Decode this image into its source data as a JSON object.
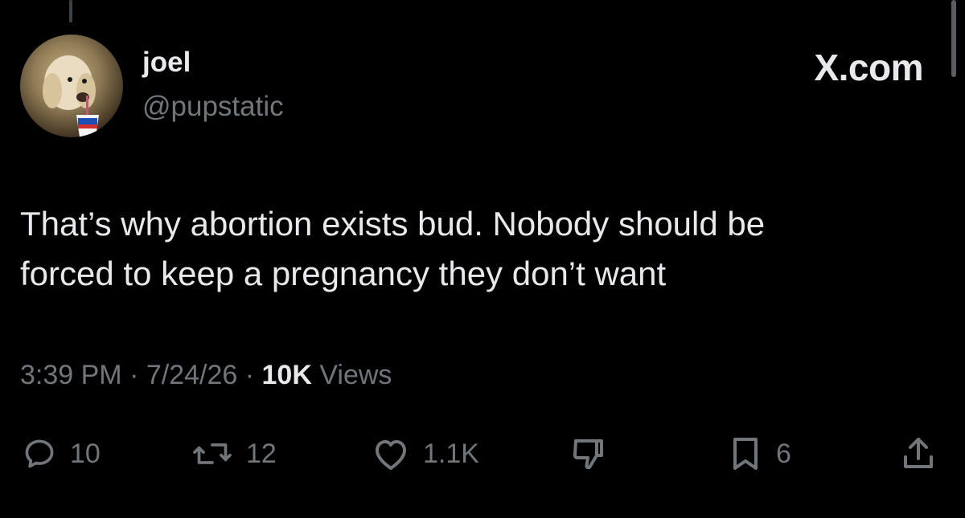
{
  "user": {
    "name": "joel",
    "handle": "@pupstatic"
  },
  "brand": "X.com",
  "tweet": {
    "line1": "That’s why abortion exists bud. Nobody should be",
    "line2": "forced to keep a pregnancy they don’t want"
  },
  "meta": {
    "time": "3:39 PM",
    "sep1": " · ",
    "date": "7/24/26",
    "sep2": " · ",
    "views_count": "10K",
    "views_label": " Views"
  },
  "actions": {
    "replies": "10",
    "reposts": "12",
    "likes": "1.1K",
    "bookmarks": "6"
  },
  "icons": [
    "reply-icon",
    "repost-icon",
    "like-icon",
    "dislike-icon",
    "bookmark-icon",
    "share-icon"
  ],
  "colors": {
    "background": "#000000",
    "primary_text": "#e7e9ea",
    "secondary_text": "#71767b"
  }
}
